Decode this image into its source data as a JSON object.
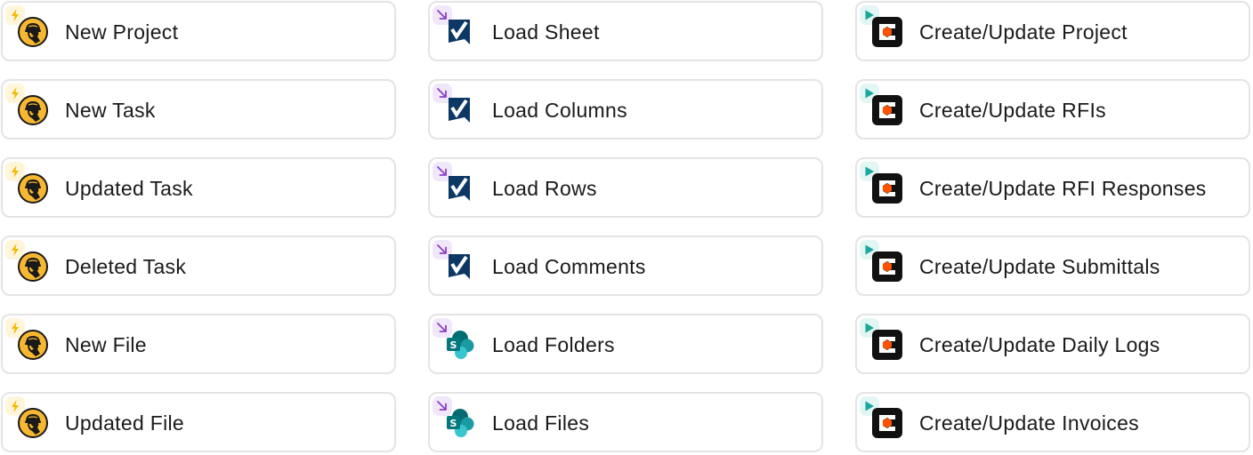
{
  "columns": [
    {
      "type": "trigger",
      "badge_icon": "lightning-bolt-icon",
      "app_icon": "construction-worker-helmet-icon",
      "items": [
        "New Project",
        "New Task",
        "Updated Task",
        "Deleted Task",
        "New File",
        "Updated File"
      ]
    },
    {
      "type": "load",
      "badge_icon": "arrow-down-right-icon",
      "items": [
        "Load Sheet",
        "Load Columns",
        "Load Rows",
        "Load Comments",
        "Load Folders",
        "Load Files"
      ],
      "app_icons": [
        "smartsheet-checkmark-icon",
        "smartsheet-checkmark-icon",
        "smartsheet-checkmark-icon",
        "smartsheet-checkmark-icon",
        "sharepoint-icon",
        "sharepoint-icon"
      ]
    },
    {
      "type": "action",
      "badge_icon": "play-icon",
      "app_icon": "procore-c-hexagon-icon",
      "items": [
        "Create/Update Project",
        "Create/Update RFIs",
        "Create/Update RFI Responses",
        "Create/Update Submittals",
        "Create/Update Daily Logs",
        "Create/Update Invoices"
      ]
    }
  ],
  "colors": {
    "trigger_badge_bg": "#fff6da",
    "trigger_bolt": "#f5b800",
    "load_badge_bg": "#f1e7fa",
    "load_arrow": "#8a3fc7",
    "action_badge_bg": "#e2f6f4",
    "action_play": "#1aa89d",
    "worker_yellow": "#f7b731",
    "smartsheet_navy": "#0d3764",
    "sharepoint_teal": "#038387",
    "procore_orange": "#ff5200"
  }
}
